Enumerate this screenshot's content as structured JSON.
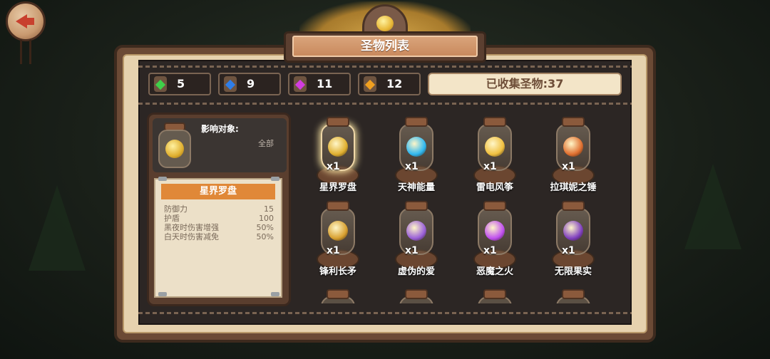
{
  "title": "圣物列表",
  "counters": [
    {
      "gem": "green",
      "color": "#3fd04a",
      "count": "5"
    },
    {
      "gem": "blue",
      "color": "#2f7ee8",
      "count": "9"
    },
    {
      "gem": "purple",
      "color": "#d23ce0",
      "count": "11"
    },
    {
      "gem": "orange",
      "color": "#f0a020",
      "count": "12"
    }
  ],
  "collected_label": "已收集圣物:37",
  "detail": {
    "affect_label": "影响对象:",
    "affect_value": "全部",
    "name": "星界罗盘",
    "stats": [
      {
        "label": "防御力",
        "value": "15"
      },
      {
        "label": "护盾",
        "value": "100"
      },
      {
        "label": "黑夜时伤害增强",
        "value": "50%"
      },
      {
        "label": "白天时伤害减免",
        "value": "50%"
      }
    ]
  },
  "items": [
    {
      "name": "星界罗盘",
      "qty": "x1",
      "color": "#e0b030",
      "icon": "compass-icon",
      "selected": true
    },
    {
      "name": "天神能量",
      "qty": "x1",
      "color": "#30b8f0",
      "icon": "energy-orb-icon"
    },
    {
      "name": "雷电风筝",
      "qty": "x1",
      "color": "#f0c040",
      "icon": "kite-icon"
    },
    {
      "name": "拉琪妮之锤",
      "qty": "x1",
      "color": "#e07030",
      "icon": "hammer-icon"
    },
    {
      "name": "锋利长矛",
      "qty": "x1",
      "color": "#d8a030",
      "icon": "spear-icon"
    },
    {
      "name": "虚伪的爱",
      "qty": "x1",
      "color": "#9a60d8",
      "icon": "heart-icon"
    },
    {
      "name": "恶魔之火",
      "qty": "x1",
      "color": "#c050f0",
      "icon": "flame-icon"
    },
    {
      "name": "无限果实",
      "qty": "x1",
      "color": "#8040c0",
      "icon": "fruit-icon"
    }
  ]
}
